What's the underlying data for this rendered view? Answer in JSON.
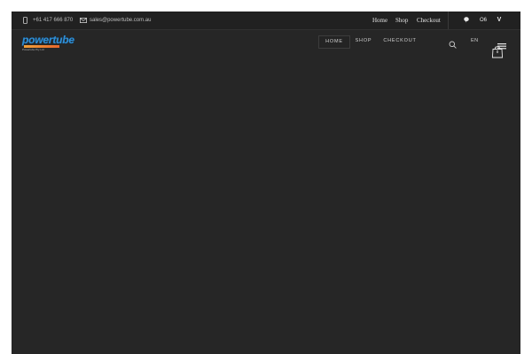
{
  "topbar": {
    "phone": "+61 417 666 870",
    "email": "sales@powertube.com.au",
    "links": [
      "Home",
      "Shop",
      "Checkout"
    ],
    "social": {
      "chat_icon": "chat-bubble-icon",
      "flickr_label": "O6",
      "vimeo_label": "V"
    }
  },
  "header": {
    "logo_text": "powertube",
    "logo_tagline": "Powertube Pty Ltd",
    "nav": [
      {
        "label": "HOME",
        "active": true
      },
      {
        "label": "SHOP",
        "active": false
      },
      {
        "label": "CHECKOUT",
        "active": false
      }
    ],
    "language": "EN",
    "cart_count": "0"
  },
  "colors": {
    "background": "#262626",
    "topbar": "#212121",
    "logo_blue": "#2f8fd6",
    "logo_orange": "#f2a23a"
  }
}
